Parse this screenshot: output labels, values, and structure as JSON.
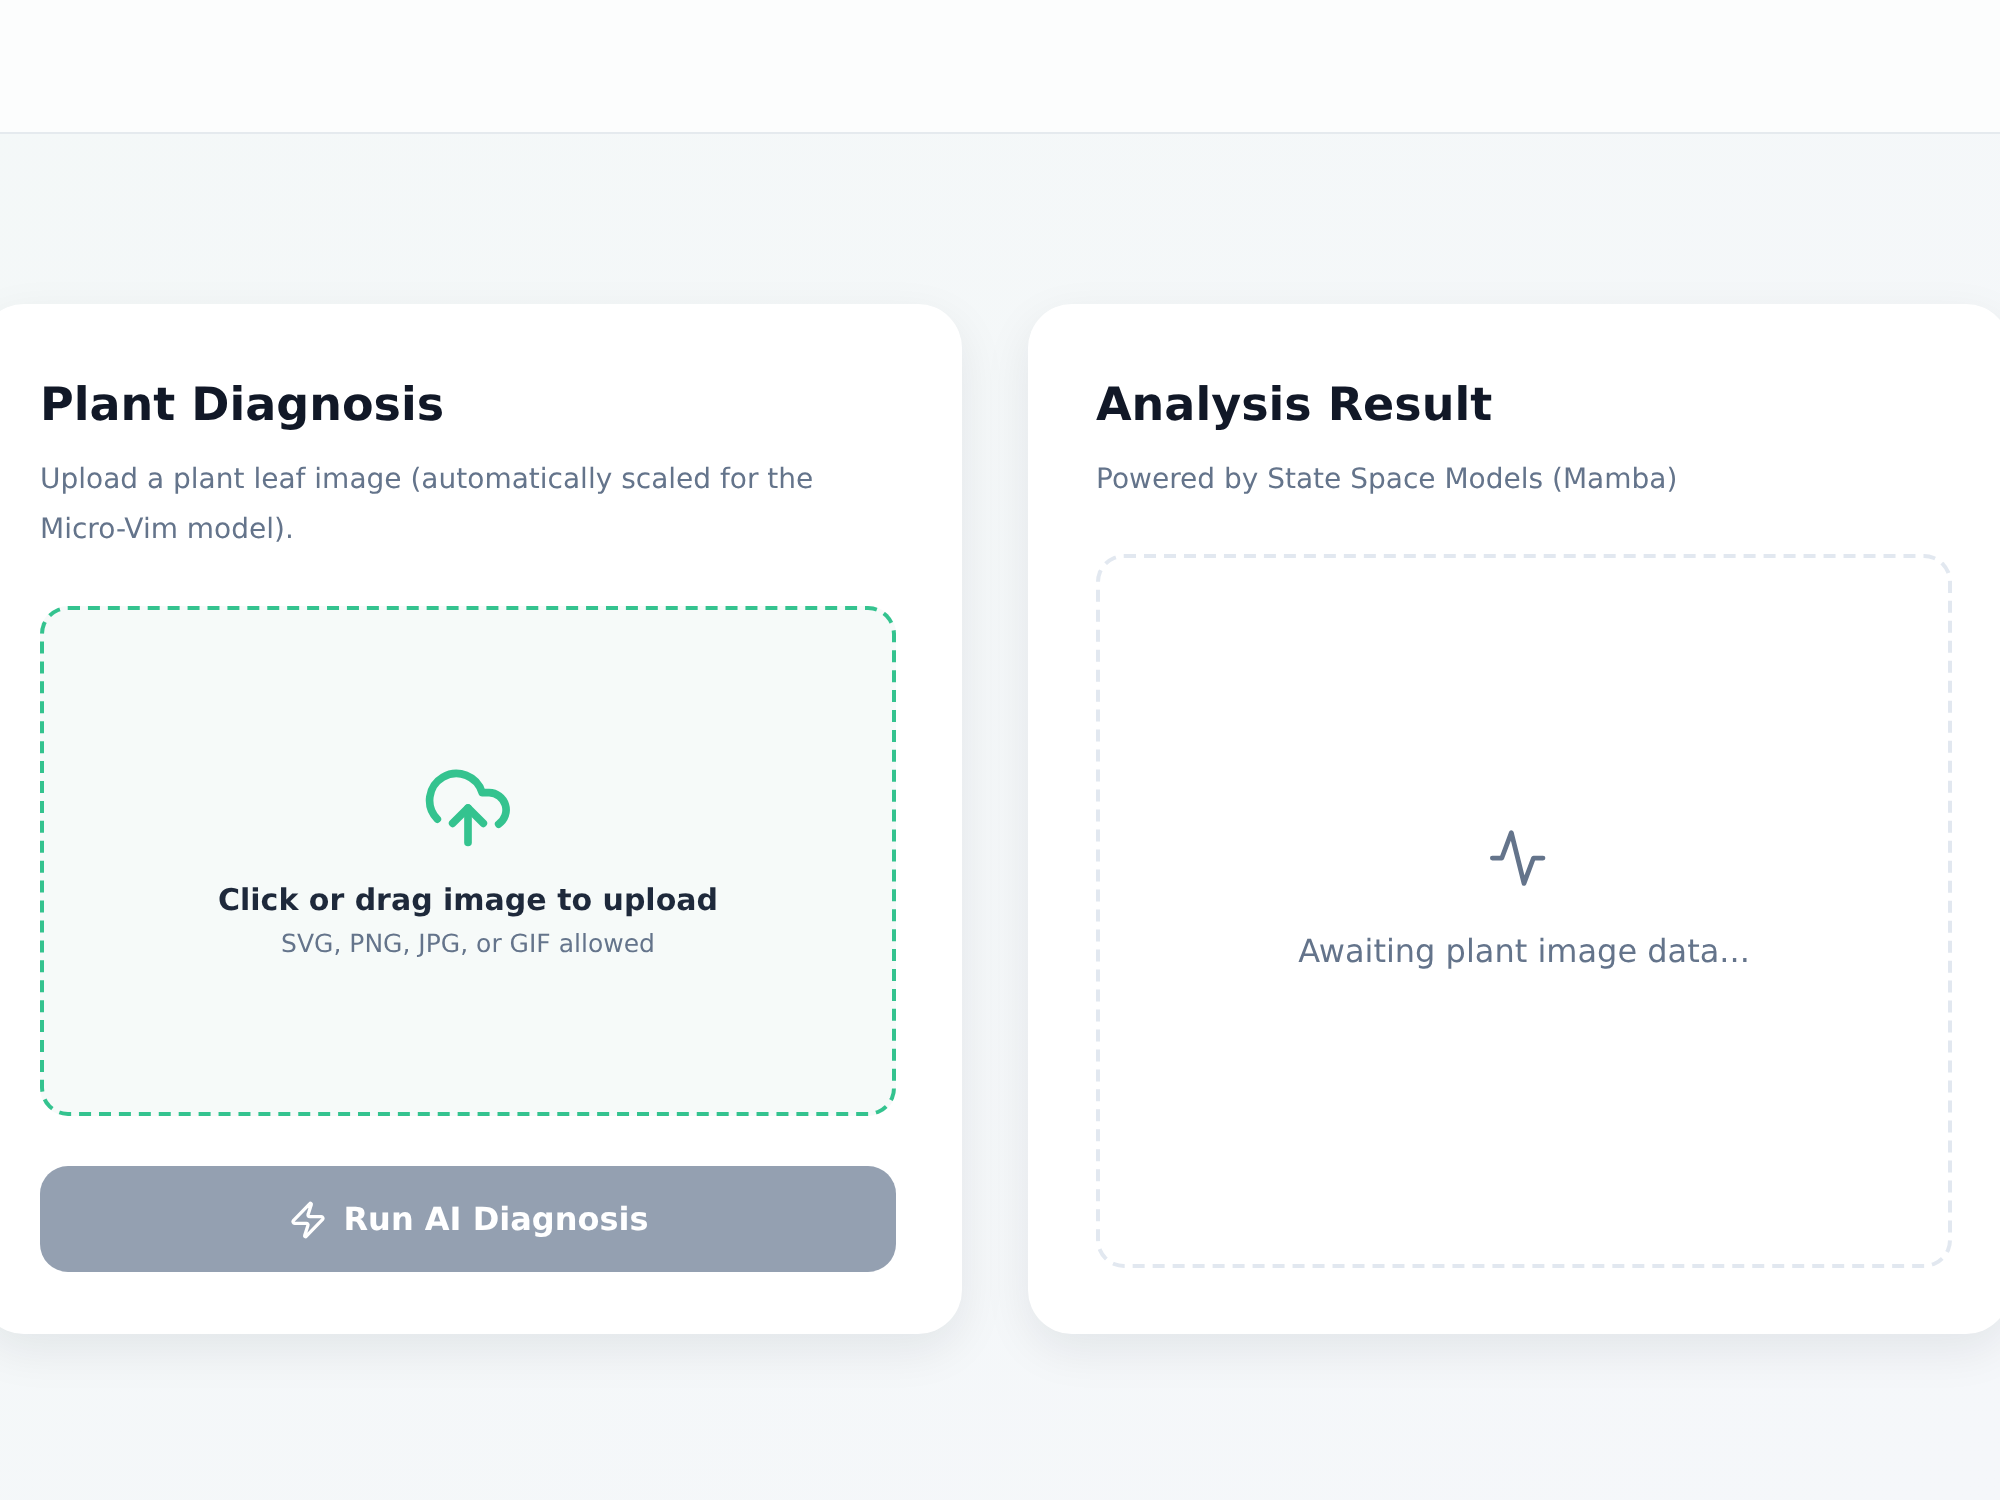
{
  "diagnosis": {
    "title": "Plant Diagnosis",
    "description": "Upload a plant leaf image (automatically scaled for the Micro-Vim model).",
    "upload": {
      "label": "Click or drag image to upload",
      "hint": "SVG, PNG, JPG, or GIF allowed"
    },
    "button": {
      "label": "Run AI Diagnosis",
      "disabled": true
    }
  },
  "result": {
    "title": "Analysis Result",
    "subtitle": "Powered by State Space Models (Mamba)",
    "empty_message": "Awaiting plant image data..."
  }
}
